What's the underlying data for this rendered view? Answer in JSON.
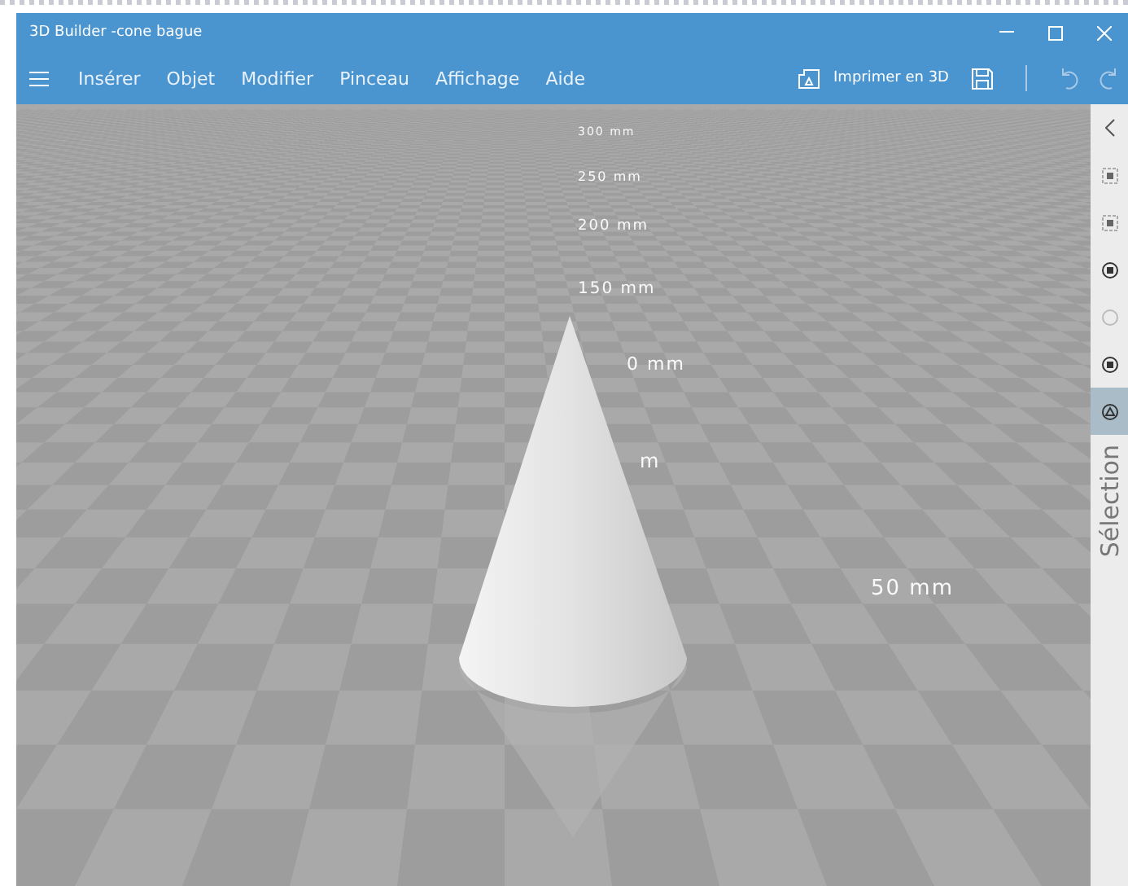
{
  "window": {
    "title": "3D Builder -cone bague"
  },
  "menu": [
    "Insérer",
    "Objet",
    "Modifier",
    "Pinceau",
    "Affichage",
    "Aide"
  ],
  "toolbar": {
    "print_label": "Imprimer en 3D"
  },
  "scene": {
    "ruler_labels": [
      "300 mm",
      "250 mm",
      "200 mm",
      "150 mm",
      "0 mm",
      "m",
      "50 mm"
    ]
  },
  "side_panel": {
    "label": "Sélection",
    "tools": [
      {
        "selected": false
      },
      {
        "selected": false
      },
      {
        "selected": false
      },
      {
        "selected": false
      },
      {
        "selected": false
      },
      {
        "selected": true
      }
    ]
  }
}
